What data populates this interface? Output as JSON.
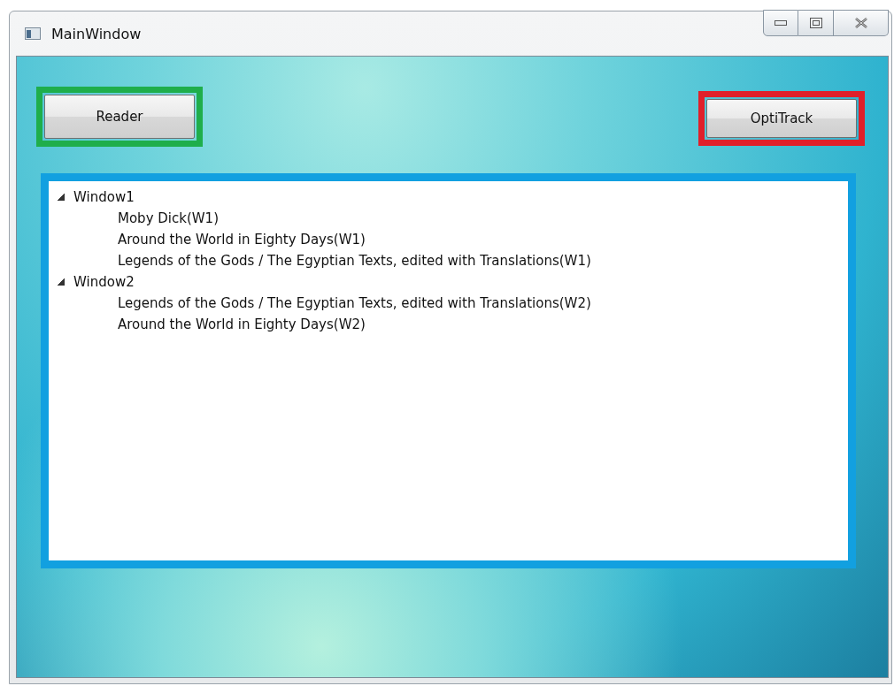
{
  "window": {
    "title": "MainWindow"
  },
  "buttons": [
    {
      "label": "Reader",
      "color": "#1fae4b"
    },
    {
      "label": "OptiTrack",
      "color": "#e0202a"
    }
  ],
  "tree": {
    "color": "#12a0e0",
    "items": [
      {
        "label": "Window1",
        "expanded": true,
        "children": [
          {
            "label": "Moby Dick(W1)"
          },
          {
            "label": "Around the World in Eighty Days(W1)"
          },
          {
            "label": "Legends of the Gods / The Egyptian Texts, edited with Translations(W1)"
          }
        ]
      },
      {
        "label": "Window2",
        "expanded": true,
        "children": [
          {
            "label": "Legends of the Gods / The Egyptian Texts, edited with Translations(W2)"
          },
          {
            "label": "Around the World in Eighty Days(W2)"
          }
        ]
      }
    ]
  }
}
